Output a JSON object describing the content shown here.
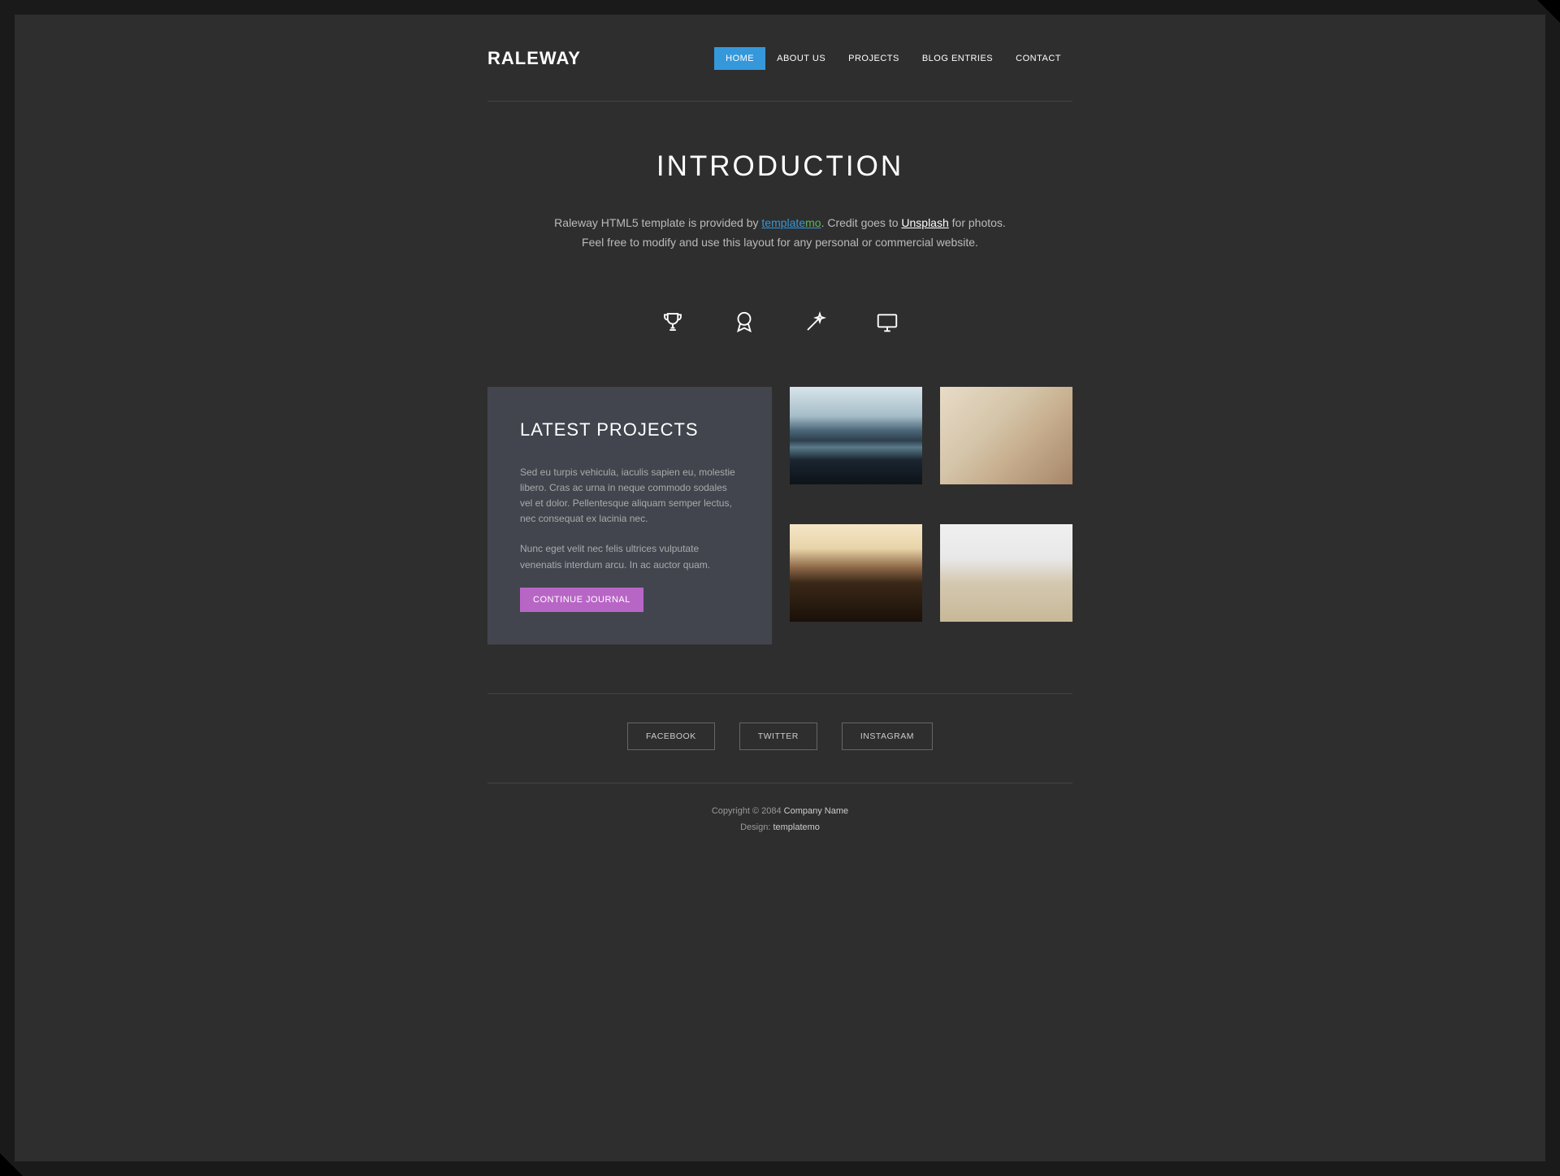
{
  "header": {
    "logo": "RALEWAY",
    "nav": [
      {
        "label": "HOME",
        "active": true
      },
      {
        "label": "ABOUT US",
        "active": false
      },
      {
        "label": "PROJECTS",
        "active": false
      },
      {
        "label": "BLOG ENTRIES",
        "active": false
      },
      {
        "label": "CONTACT",
        "active": false
      }
    ]
  },
  "intro": {
    "heading": "INTRODUCTION",
    "text_before": "Raleway HTML5 template is provided by ",
    "link1_a": "template",
    "link1_b": "mo",
    "text_mid1": ". Credit goes to ",
    "link2": "Unsplash",
    "text_after": " for photos. Feel free to modify and use this layout for any personal or commercial website."
  },
  "icons": [
    "trophy-icon",
    "award-icon",
    "wand-icon",
    "monitor-icon"
  ],
  "projects": {
    "heading": "LATEST PROJECTS",
    "p1": "Sed eu turpis vehicula, iaculis sapien eu, molestie libero. Cras ac urna in neque commodo sodales vel et dolor. Pellentesque aliquam semper lectus, nec consequat ex lacinia nec.",
    "p2": "Nunc eget velit nec felis ultrices vulputate venenatis interdum arcu. In ac auctor quam.",
    "button": "CONTINUE JOURNAL",
    "thumbs": [
      "mountain-lake",
      "holding-map",
      "ocean-cliff",
      "desk-laptop"
    ]
  },
  "footer": {
    "socials": [
      "FACEBOOK",
      "TWITTER",
      "INSTAGRAM"
    ],
    "copy_prefix": "Copyright © 2084 ",
    "company": "Company Name",
    "design_prefix": "Design: ",
    "design_link": "templatemo"
  }
}
